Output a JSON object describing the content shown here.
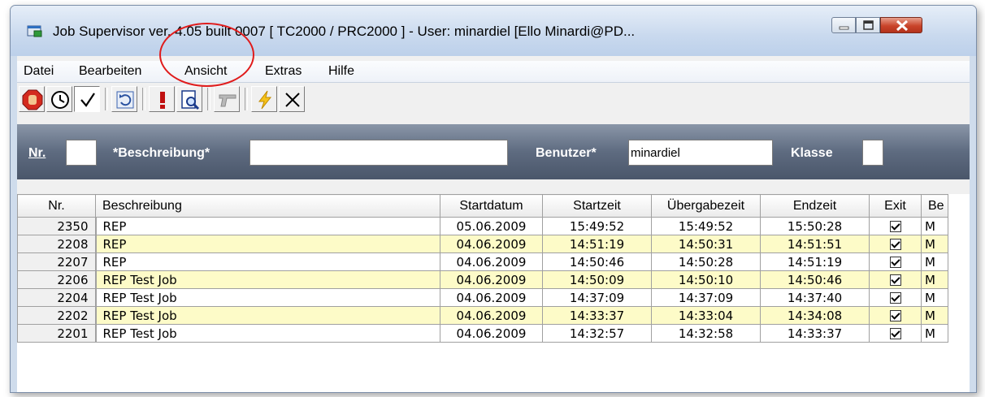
{
  "window": {
    "title": "Job Supervisor ver. 4.05 built 0007    [ TC2000 / PRC2000 ] - User: minardiel [Ello Minardi@PD..."
  },
  "menu": {
    "items": [
      "Datei",
      "Bearbeiten",
      "Ansicht",
      "Extras",
      "Hilfe"
    ]
  },
  "toolbar": {
    "buttons": [
      "stop-hand-icon",
      "clock-icon",
      "checkmark-icon",
      "refresh-icon",
      "exclamation-icon",
      "document-search-icon",
      "pistol-icon",
      "lightning-icon",
      "cross-icon"
    ]
  },
  "filter": {
    "nr_label": "Nr.",
    "nr_value": "",
    "desc_label": "*Beschreibung*",
    "desc_value": "",
    "user_label": "Benutzer*",
    "user_value": "minardiel",
    "class_label": "Klasse",
    "class_value": ""
  },
  "grid": {
    "columns": [
      "Nr.",
      "Beschreibung",
      "Startdatum",
      "Startzeit",
      "Übergabezeit",
      "Endzeit",
      "Exit",
      "Be"
    ],
    "rows": [
      {
        "nr": "2350",
        "desc": "REP",
        "date": "05.06.2009",
        "start": "15:49:52",
        "handover": "15:49:52",
        "end": "15:50:28",
        "exit": true,
        "be": "M"
      },
      {
        "nr": "2208",
        "desc": "REP",
        "date": "04.06.2009",
        "start": "14:51:19",
        "handover": "14:50:31",
        "end": "14:51:51",
        "exit": true,
        "be": "M"
      },
      {
        "nr": "2207",
        "desc": "REP",
        "date": "04.06.2009",
        "start": "14:50:46",
        "handover": "14:50:28",
        "end": "14:51:19",
        "exit": true,
        "be": "M"
      },
      {
        "nr": "2206",
        "desc": "REP Test Job",
        "date": "04.06.2009",
        "start": "14:50:09",
        "handover": "14:50:10",
        "end": "14:50:46",
        "exit": true,
        "be": "M"
      },
      {
        "nr": "2204",
        "desc": "REP Test Job",
        "date": "04.06.2009",
        "start": "14:37:09",
        "handover": "14:37:09",
        "end": "14:37:40",
        "exit": true,
        "be": "M"
      },
      {
        "nr": "2202",
        "desc": "REP Test Job",
        "date": "04.06.2009",
        "start": "14:33:37",
        "handover": "14:33:04",
        "end": "14:34:08",
        "exit": true,
        "be": "M"
      },
      {
        "nr": "2201",
        "desc": "REP Test Job",
        "date": "04.06.2009",
        "start": "14:32:57",
        "handover": "14:32:58",
        "end": "14:33:37",
        "exit": true,
        "be": "M"
      }
    ]
  },
  "colors": {
    "row_highlight": "#fdfbc8",
    "filter_bar": "#5e6b80",
    "annotation": "#e01b1b"
  }
}
